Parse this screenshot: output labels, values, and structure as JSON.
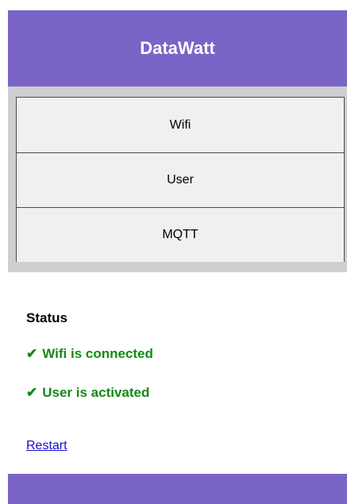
{
  "header": {
    "title": "DataWatt"
  },
  "nav": {
    "items": [
      {
        "label": "Wifi"
      },
      {
        "label": "User"
      },
      {
        "label": "MQTT"
      }
    ]
  },
  "status": {
    "title": "Status",
    "lines": [
      {
        "check": "✔",
        "text": "Wifi is connected"
      },
      {
        "check": "✔",
        "text": "User is activated"
      }
    ]
  },
  "links": {
    "restart": "Restart"
  },
  "colors": {
    "brand": "#7a64c8",
    "success": "#148a14",
    "link": "#1a0dcc",
    "nav_bg": "#f0f0f0",
    "nav_frame": "#cfcfcf"
  }
}
